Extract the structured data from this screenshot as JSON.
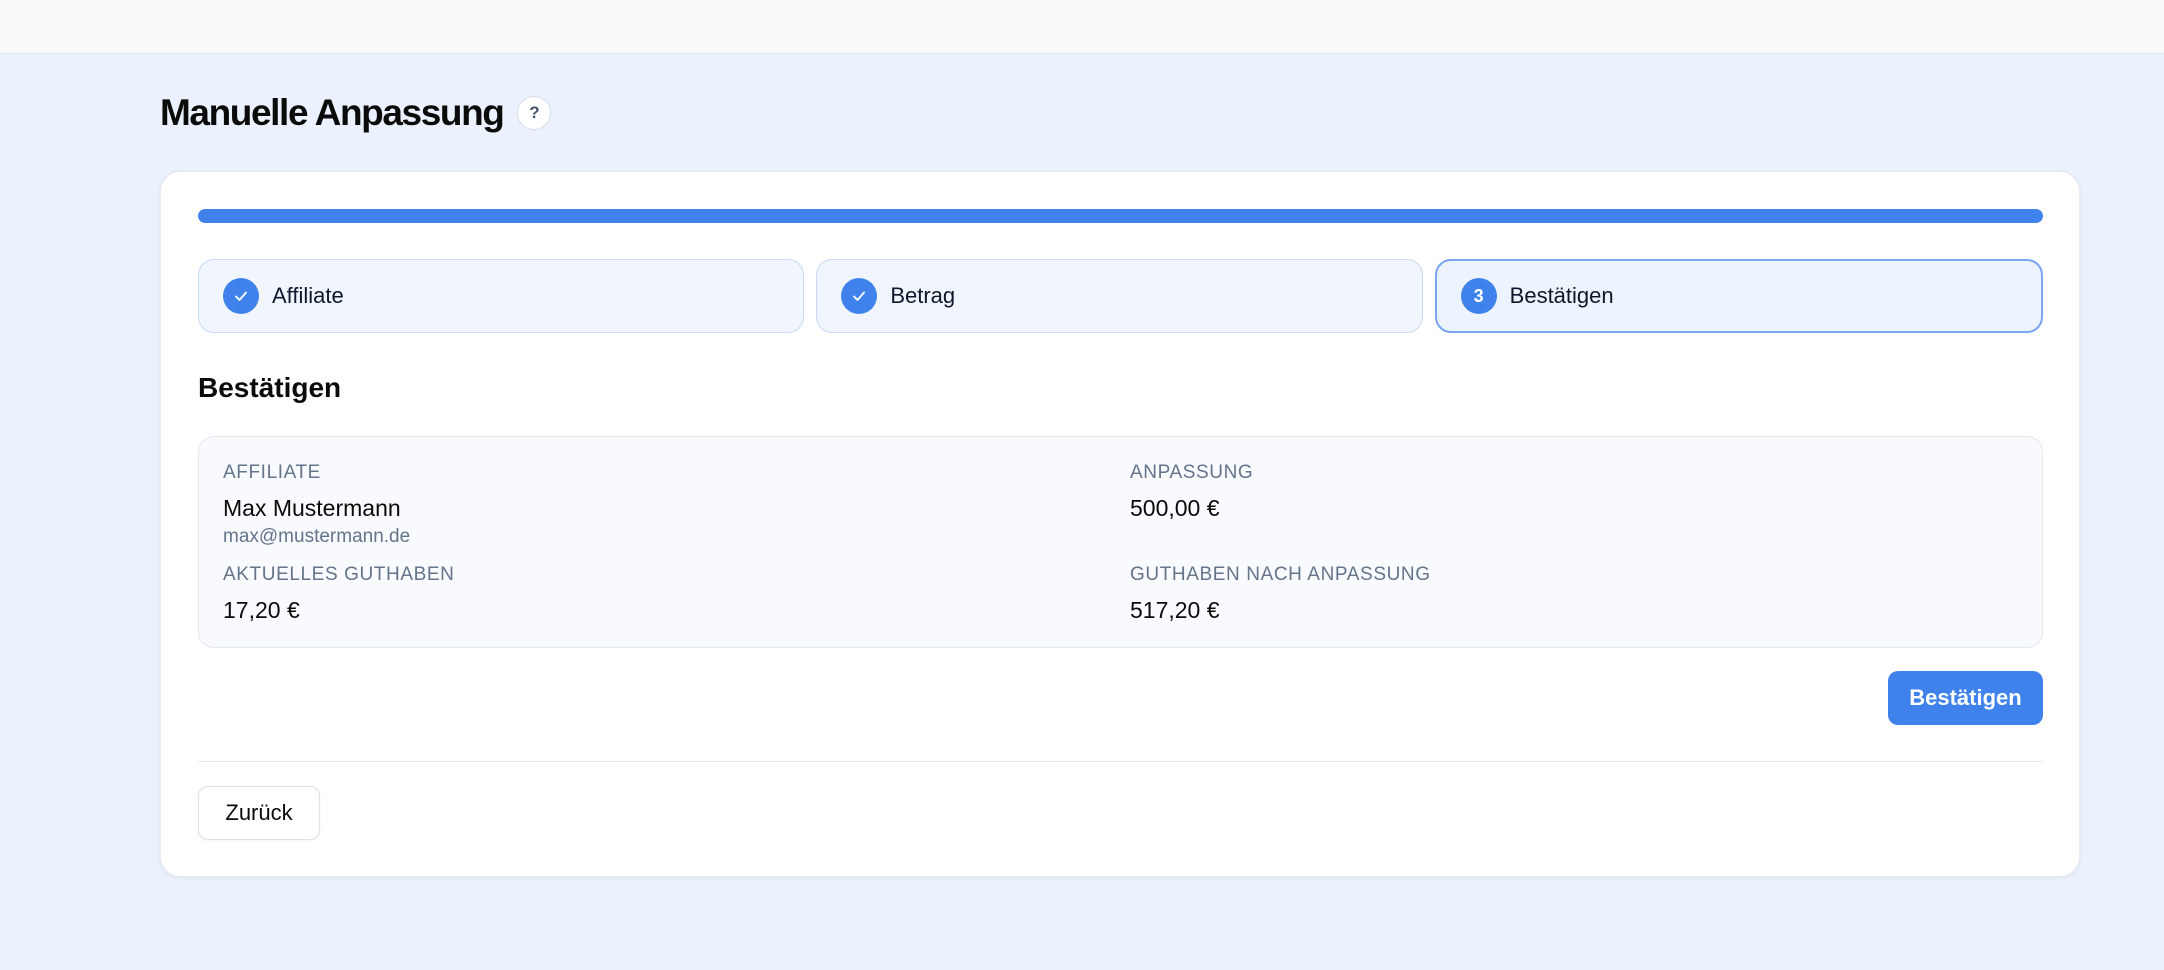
{
  "header": {
    "title": "Manuelle Anpassung",
    "help_symbol": "?"
  },
  "progress": {
    "percent": 100
  },
  "steps": [
    {
      "label": "Affiliate",
      "status": "completed",
      "icon": "check-icon"
    },
    {
      "label": "Betrag",
      "status": "completed",
      "icon": "check-icon"
    },
    {
      "label": "Bestätigen",
      "status": "active",
      "number": "3"
    }
  ],
  "section": {
    "title": "Bestätigen"
  },
  "summary": {
    "affiliate_label": "AFFILIATE",
    "affiliate_name": "Max Mustermann",
    "affiliate_email": "max@mustermann.de",
    "adjustment_label": "ANPASSUNG",
    "adjustment_value": "500,00 €",
    "current_balance_label": "AKTUELLES GUTHABEN",
    "current_balance_value": "17,20 €",
    "new_balance_label": "GUTHABEN NACH ANPASSUNG",
    "new_balance_value": "517,20 €"
  },
  "actions": {
    "confirm_label": "Bestätigen",
    "back_label": "Zurück"
  },
  "colors": {
    "accent": "#3f82ec",
    "page_background": "#ecf2fd"
  }
}
